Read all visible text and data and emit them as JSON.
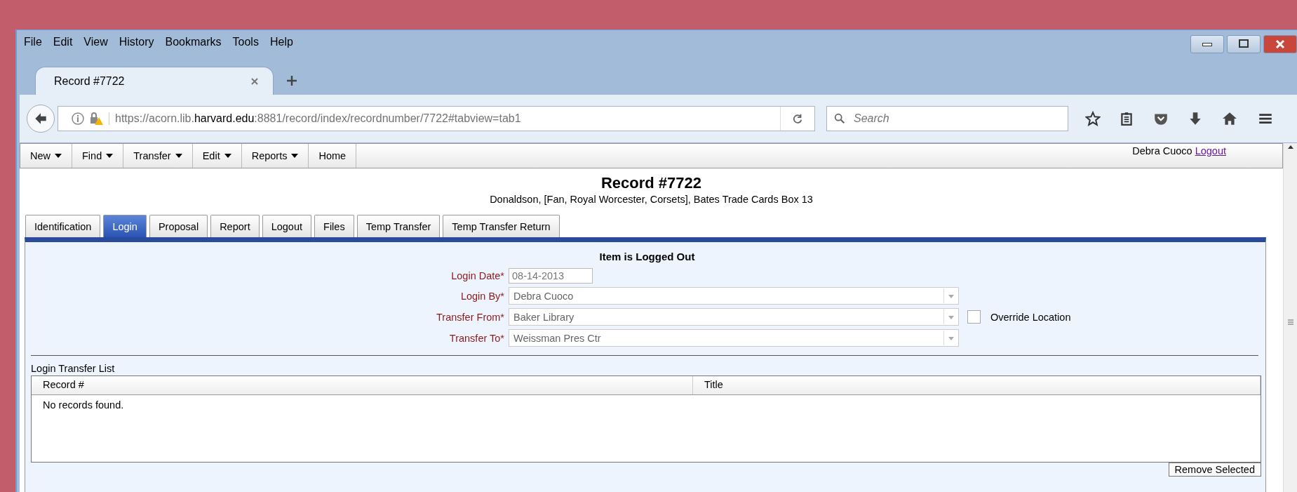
{
  "menu_bar": [
    "File",
    "Edit",
    "View",
    "History",
    "Bookmarks",
    "Tools",
    "Help"
  ],
  "browser_tab": {
    "title": "Record #7722",
    "selected": true
  },
  "address_bar": {
    "url": "https://acorn.lib.**harvard.edu**:8881/record/index/recordnumber/7722#tabview=tab1"
  },
  "search_field": {
    "placeholder": "Search"
  },
  "app_menu": [
    {
      "label": "New",
      "dropdown": true
    },
    {
      "label": "Find",
      "dropdown": true
    },
    {
      "label": "Transfer",
      "dropdown": true
    },
    {
      "label": "Edit",
      "dropdown": true
    },
    {
      "label": "Reports",
      "dropdown": true
    },
    {
      "label": "Home",
      "dropdown": false
    }
  ],
  "user": {
    "name": "Debra Cuoco",
    "logout": "Logout"
  },
  "record": {
    "title": "Record #7722",
    "subtitle": "Donaldson, [Fan, Royal Worcester, Corsets], Bates Trade Cards Box 13"
  },
  "tabs": [
    {
      "label": "Identification",
      "selected": false
    },
    {
      "label": "Login",
      "selected": true
    },
    {
      "label": "Proposal",
      "selected": false
    },
    {
      "label": "Report",
      "selected": false
    },
    {
      "label": "Logout",
      "selected": false
    },
    {
      "label": "Files",
      "selected": false
    },
    {
      "label": "Temp Transfer",
      "selected": false
    },
    {
      "label": "Temp Transfer Return",
      "selected": false
    }
  ],
  "status": "Item is Logged Out",
  "form": [
    {
      "label": "Login Date*",
      "value": "08-14-2013",
      "kind": "text"
    },
    {
      "label": "Login By*",
      "value": "Debra Cuoco",
      "kind": "select"
    },
    {
      "label": "Transfer From*",
      "value": "Baker Library",
      "kind": "select"
    },
    {
      "label": "Transfer To*",
      "value": "Weissman Pres Ctr",
      "kind": "select"
    }
  ],
  "override": {
    "label": "Override Location",
    "checked": false
  },
  "list_title": "Login Transfer List",
  "table": {
    "columns": [
      "Record #",
      "Title"
    ],
    "empty_message": "No records found."
  },
  "remove_button": "Remove Selected"
}
